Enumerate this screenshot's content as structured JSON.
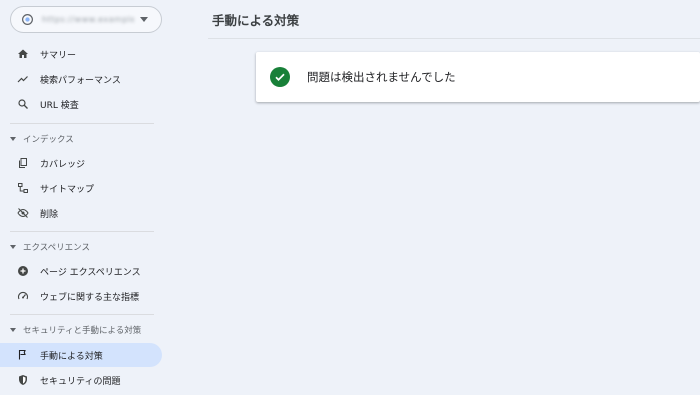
{
  "colors": {
    "accent": "#188038",
    "active_bg": "#d3e3fd",
    "background": "#eef2f9"
  },
  "property": {
    "url": "https://www.example.com/",
    "icon": "globe-icon"
  },
  "nav": {
    "summary": {
      "label": "サマリー",
      "icon": "home-icon"
    },
    "performance": {
      "label": "検索パフォーマンス",
      "icon": "trending-up-icon"
    },
    "url_inspection": {
      "label": "URL 検査",
      "icon": "search-icon"
    },
    "index_section": "インデックス",
    "coverage": {
      "label": "カバレッジ",
      "icon": "copy-icon"
    },
    "sitemaps": {
      "label": "サイトマップ",
      "icon": "sitemap-icon"
    },
    "removals": {
      "label": "削除",
      "icon": "visibility-off-icon"
    },
    "experience_section": "エクスペリエンス",
    "page_experience": {
      "label": "ページ エクスペリエンス",
      "icon": "plus-circle-icon"
    },
    "core_web_vitals": {
      "label": "ウェブに関する主な指標",
      "icon": "speed-icon"
    },
    "security_section": "セキュリティと手動による対策",
    "manual_actions": {
      "label": "手動による対策",
      "icon": "flag-icon"
    },
    "security_issues": {
      "label": "セキュリティの問題",
      "icon": "shield-icon"
    }
  },
  "main": {
    "title": "手動による対策",
    "status_text": "問題は検出されませんでした",
    "status_icon": "check-circle-icon"
  }
}
